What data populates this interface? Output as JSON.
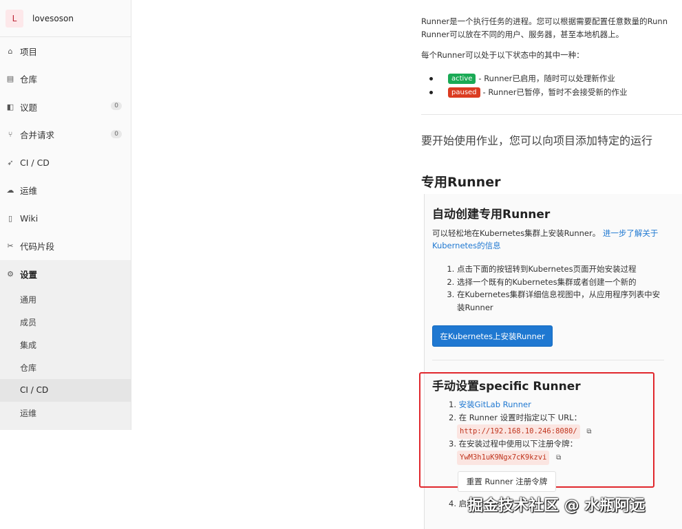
{
  "sidebar": {
    "avatar_letter": "L",
    "project_name": "lovesoson",
    "items": [
      {
        "label": "项目",
        "icon": "home-icon"
      },
      {
        "label": "仓库",
        "icon": "repo-icon"
      },
      {
        "label": "议题",
        "icon": "issues-icon",
        "count": "0"
      },
      {
        "label": "合并请求",
        "icon": "merge-request-icon",
        "count": "0"
      },
      {
        "label": "CI / CD",
        "icon": "rocket-icon"
      },
      {
        "label": "运维",
        "icon": "cloud-gear-icon"
      },
      {
        "label": "Wiki",
        "icon": "book-icon"
      },
      {
        "label": "代码片段",
        "icon": "scissors-icon"
      },
      {
        "label": "设置",
        "icon": "gear-icon"
      }
    ],
    "settings_sub": [
      "通用",
      "成员",
      "集成",
      "仓库",
      "CI / CD",
      "运维"
    ]
  },
  "main": {
    "intro_line1": "Runner是一个执行任务的进程。您可以根据需要配置任意数量的Runn",
    "intro_line2": "Runner可以放在不同的用户、服务器，甚至本地机器上。",
    "states_intro": "每个Runner可以处于以下状态中的其中一种：",
    "states": [
      {
        "badge": "active",
        "text": " - Runner已启用，随时可以处理新作业",
        "color": "#1aaa55"
      },
      {
        "badge": "paused",
        "text": " - Runner已暂停，暂时不会接受新的作业",
        "color": "#db3b21"
      }
    ],
    "lead": "要开始使用作业，您可以向项目添加特定的运行",
    "specific_title": "专用Runner",
    "auto_title": "自动创建专用Runner",
    "auto_desc": "可以轻松地在Kubernetes集群上安装Runner。",
    "auto_link": "进一步了解关于Kubernetes的信息",
    "auto_steps": [
      "点击下面的按钮转到Kubernetes页面开始安装过程",
      "选择一个既有的Kubernetes集群或者创建一个新的",
      "在Kubernetes集群详细信息视图中，从应用程序列表中安装Runner"
    ],
    "install_button": "在Kubernetes上安装Runner",
    "manual_title": "手动设置specific Runner",
    "manual_step1_link": "安装GitLab Runner",
    "manual_step2": "在 Runner 设置时指定以下 URL：",
    "url": "http://192.168.10.246:8080/",
    "manual_step3": "在安装过程中使用以下注册令牌：",
    "token": "YwM3h1uK9Ngx7cK9kzvi",
    "reset_button": "重置 Runner 注册令牌",
    "step4": "4. 启动"
  },
  "watermark": "掘金技术社区 @ 水瓶阿远",
  "colors": {
    "accent": "#1f78d1",
    "highlight_box": "#e0262b"
  }
}
